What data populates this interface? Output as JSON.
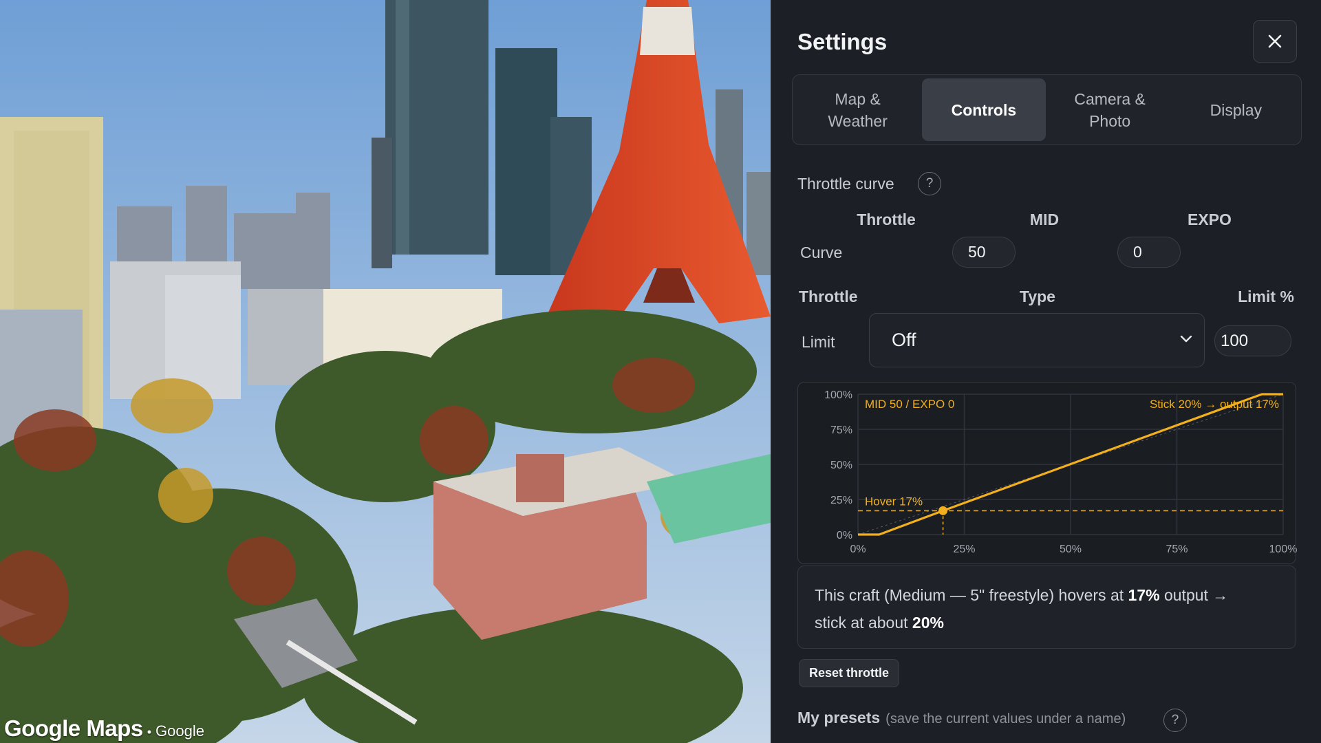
{
  "map": {
    "attribution_logo": "Google Maps",
    "attribution_separator": "•",
    "attribution_text": "Google"
  },
  "settings": {
    "title": "Settings",
    "close_icon": "close-icon",
    "tabs": [
      {
        "label": "Map &\nWeather",
        "active": false
      },
      {
        "label": "Controls",
        "active": true
      },
      {
        "label": "Camera &\nPhoto",
        "active": false
      },
      {
        "label": "Display",
        "active": false
      }
    ],
    "throttle_curve": {
      "section_label": "Throttle curve",
      "help": "?",
      "col_throttle": "Throttle",
      "col_mid": "MID",
      "col_expo": "EXPO",
      "row_label": "Curve",
      "mid_value": "50",
      "expo_value": "0"
    },
    "throttle_limit": {
      "col_throttle": "Throttle",
      "col_type": "Type",
      "col_limit": "Limit %",
      "row_label": "Limit",
      "type_value": "Off",
      "limit_value": "100"
    },
    "info": {
      "prefix": "This craft (Medium — 5\" freestyle) hovers at ",
      "hover": "17%",
      "middle": " output →",
      "line2": "stick at about ",
      "stick": "20%"
    },
    "reset_label": "Reset throttle",
    "presets": {
      "title": "My presets",
      "hint": "(save the current values under a name)",
      "help": "?"
    }
  },
  "chart_data": {
    "type": "line",
    "x_tick_labels": [
      "0%",
      "25%",
      "50%",
      "75%",
      "100%"
    ],
    "y_tick_labels": [
      "0%",
      "25%",
      "50%",
      "75%",
      "100%"
    ],
    "xlim": [
      0,
      100
    ],
    "ylim": [
      0,
      100
    ],
    "grid": true,
    "series": [
      {
        "x": [
          0,
          5,
          20,
          95,
          100
        ],
        "y": [
          0,
          0,
          17,
          100,
          100
        ],
        "color": "#f2b01e"
      }
    ],
    "annotations": {
      "curve_label": "MID 50 / EXPO 0",
      "stick_label": "Stick 20% → output 17%",
      "hover_label": "Hover 17%",
      "hover_point": {
        "x": 20,
        "y": 17
      }
    },
    "accent_color": "#f2b01e"
  }
}
